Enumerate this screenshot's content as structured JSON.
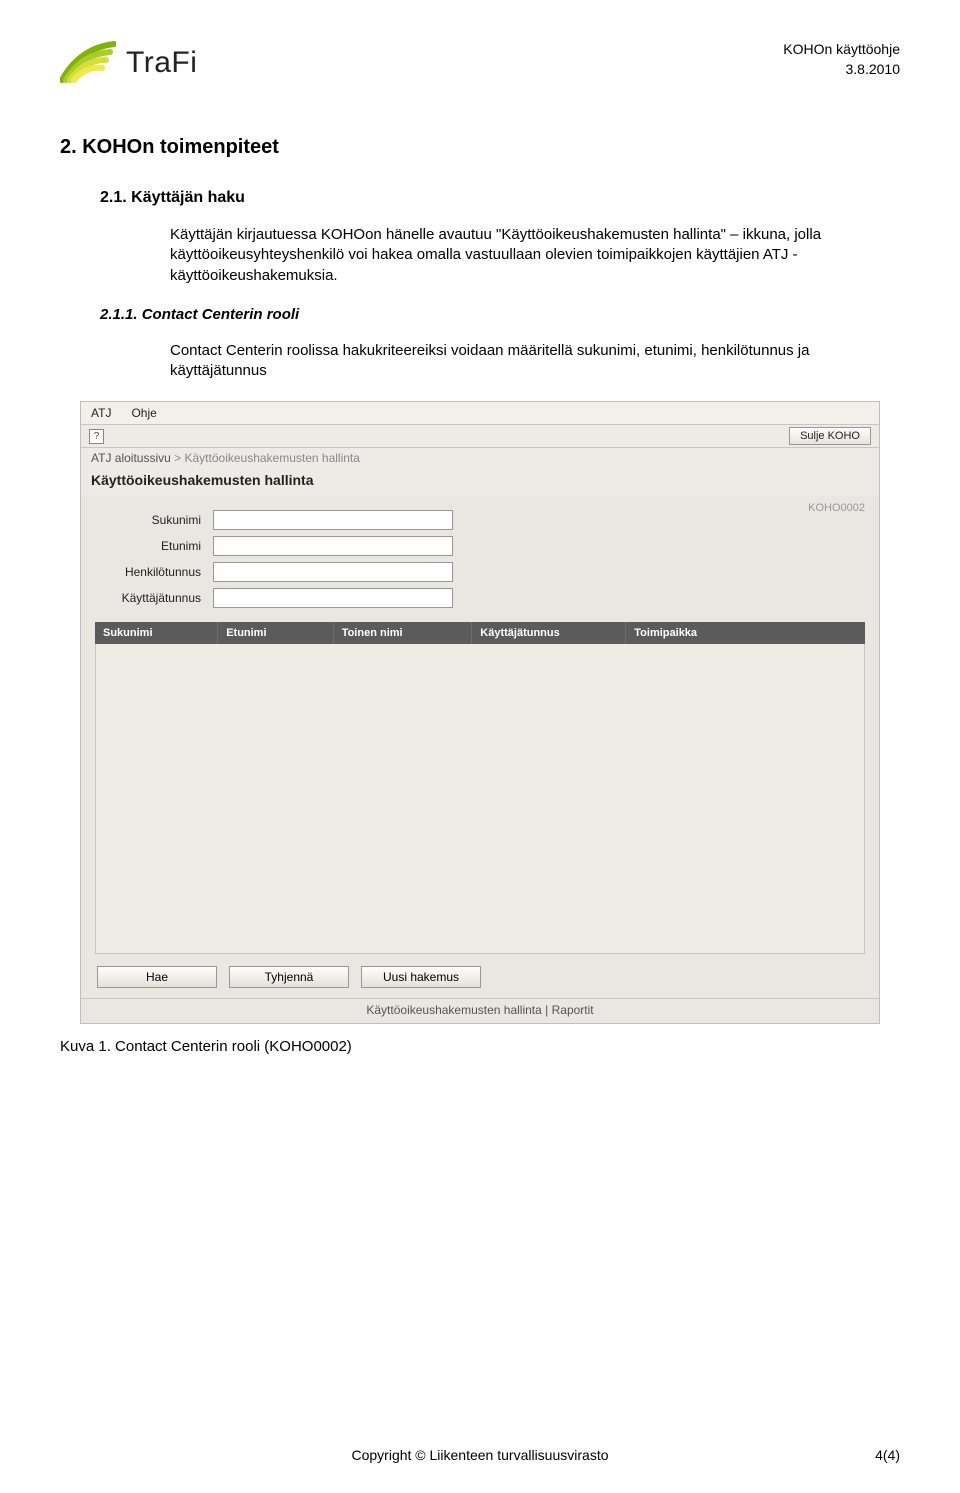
{
  "doc": {
    "title_top": "KOHOn käyttöohje",
    "date": "3.8.2010",
    "logo_text": "TraFi"
  },
  "sections": {
    "h2": "2. KOHOn toimenpiteet",
    "h3": "2.1. Käyttäjän haku",
    "para1": "Käyttäjän kirjautuessa KOHOon hänelle avautuu \"Käyttöoikeushakemusten hallinta\" – ikkuna, jolla käyttöoikeusyhteyshenkilö voi hakea omalla vastuullaan olevien toimipaikkojen käyttäjien ATJ -käyttöoikeushakemuksia.",
    "h4": "2.1.1. Contact Centerin rooli",
    "para2": "Contact Centerin roolissa hakukriteereiksi voidaan määritellä sukunimi, etunimi, henkilötunnus ja käyttäjätunnus"
  },
  "screenshot": {
    "menu": {
      "item1": "ATJ",
      "item2": "Ohje"
    },
    "help_symbol": "?",
    "close_btn": "Sulje KOHO",
    "crumb1": "ATJ aloitussivu",
    "crumb_sep": " > ",
    "crumb2": "Käyttöoikeushakemusten hallinta",
    "page_title": "Käyttöoikeushakemusten hallinta",
    "page_id": "KOHO0002",
    "fields": {
      "sukunimi": "Sukunimi",
      "etunimi": "Etunimi",
      "henkilotunnus": "Henkilötunnus",
      "kayttajatunnus": "Käyttäjätunnus"
    },
    "cols": {
      "c1": "Sukunimi",
      "c2": "Etunimi",
      "c3": "Toinen nimi",
      "c4": "Käyttäjätunnus",
      "c5": "Toimipaikka"
    },
    "buttons": {
      "hae": "Hae",
      "tyhjenna": "Tyhjennä",
      "uusi": "Uusi hakemus"
    },
    "bottom_links": "Käyttöoikeushakemusten hallinta  |  Raportit"
  },
  "caption": "Kuva 1. Contact Centerin rooli (KOHO0002)",
  "footer": {
    "copyright": "Copyright © Liikenteen turvallisuusvirasto",
    "page": "4(4)"
  }
}
